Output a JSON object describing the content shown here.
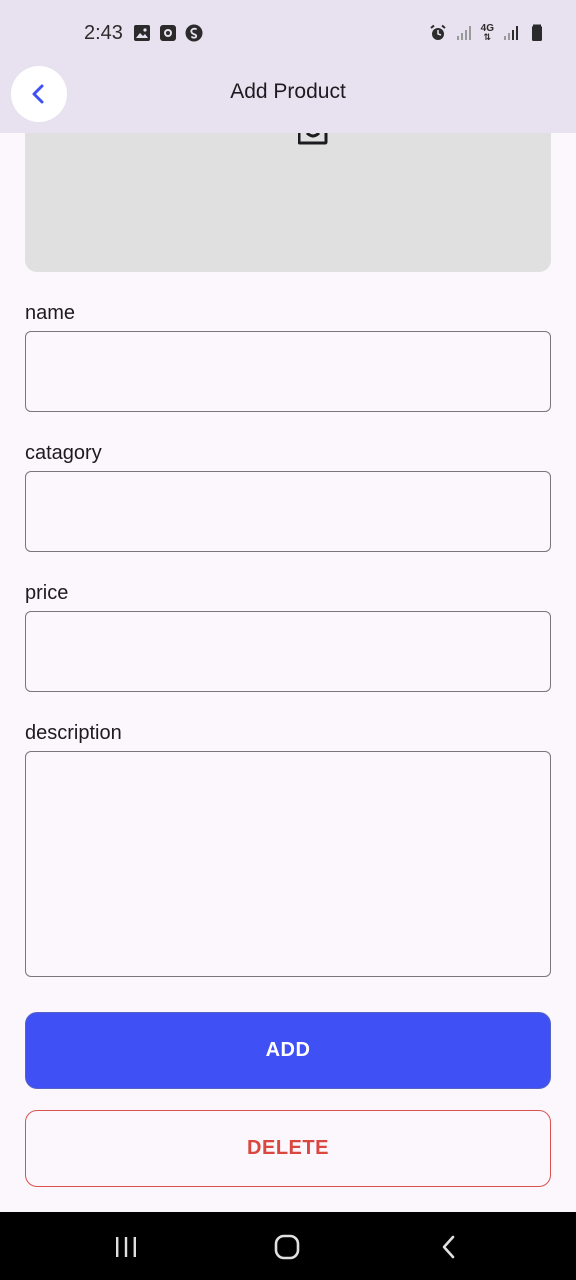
{
  "status_bar": {
    "time": "2:43",
    "left_icons": [
      "image-icon",
      "screen-record-icon",
      "shazam-icon"
    ],
    "right_icons": [
      "alarm-icon",
      "signal-icon",
      "4g-data-icon",
      "signal-icon",
      "battery-icon"
    ],
    "network_label": "4G"
  },
  "app_bar": {
    "title": "Add Product",
    "back_icon": "chevron-left-icon"
  },
  "form": {
    "fields": [
      {
        "label": "name",
        "value": ""
      },
      {
        "label": "catagory",
        "value": ""
      },
      {
        "label": "price",
        "value": ""
      },
      {
        "label": "description",
        "value": ""
      }
    ],
    "image_picker_icon": "camera-icon"
  },
  "actions": {
    "add_label": "ADD",
    "delete_label": "DELETE"
  },
  "colors": {
    "app_bar": "#e8e1ef",
    "background": "#fcf6fd",
    "add_button": "#3f51f5",
    "delete_border": "#d9534f",
    "back_icon": "#3f51f5"
  },
  "nav_bar": {
    "buttons": [
      "recent-apps-icon",
      "home-icon",
      "back-icon"
    ]
  }
}
